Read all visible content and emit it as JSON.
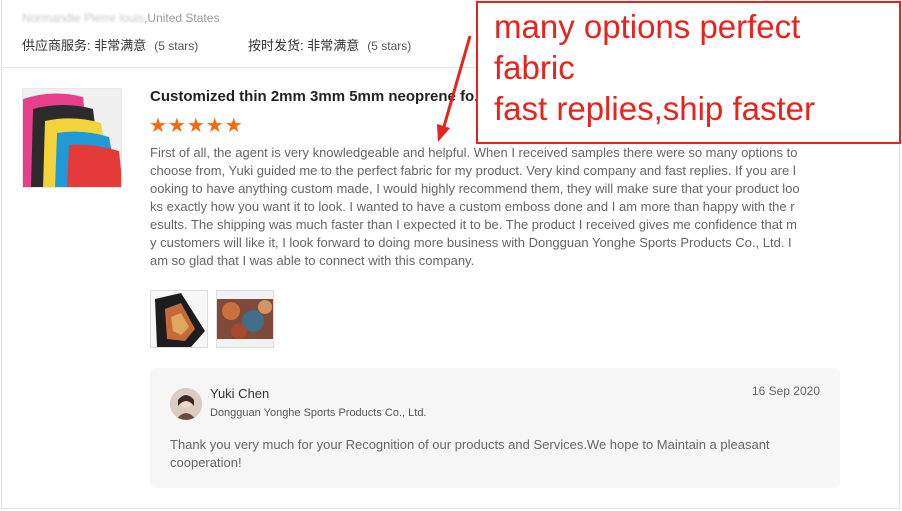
{
  "supplier": {
    "location_blurred": "Normandie Pierre louis",
    "location": ",United States",
    "ratings": [
      {
        "label": "供应商服务: 非常满意",
        "detail": "(5 stars)"
      },
      {
        "label": "按时发货: 非常满意",
        "detail": "(5 stars)"
      }
    ]
  },
  "review": {
    "product_title": "Customized thin 2mm 3mm 5mm neoprene fo...",
    "stars": "★★★★★",
    "text": "First of all, the agent is very knowledgeable and helpful. When I received samples there were so many options to choose from, Yuki guided me to the perfect fabric for my product. Very kind company and fast replies. If you are looking to have anything custom made, I would highly recommend them, they will make sure that your product looks exactly how you want it to look. I wanted to have a custom emboss done and I am more than happy with the results. The shipping was much faster than I expected it to be. The product I received gives me confidence that my customers will like it, I look forward to doing more business with Dongguan Yonghe Sports Products Co., Ltd. I am so glad that I was able to connect with this company."
  },
  "reply": {
    "name": "Yuki Chen",
    "company": "Dongguan Yonghe Sports Products Co., Ltd.",
    "date": "16 Sep 2020",
    "text": "Thank you very much for your Recognition of our products and Services.We hope to Maintain a pleasant cooperation!"
  },
  "annotation": {
    "text": "many options perfect\nfabric\nfast replies,ship faster",
    "color": "#e8231d"
  },
  "colors": {
    "star": "#f36a10",
    "reply_bg": "#f6f6f6"
  }
}
